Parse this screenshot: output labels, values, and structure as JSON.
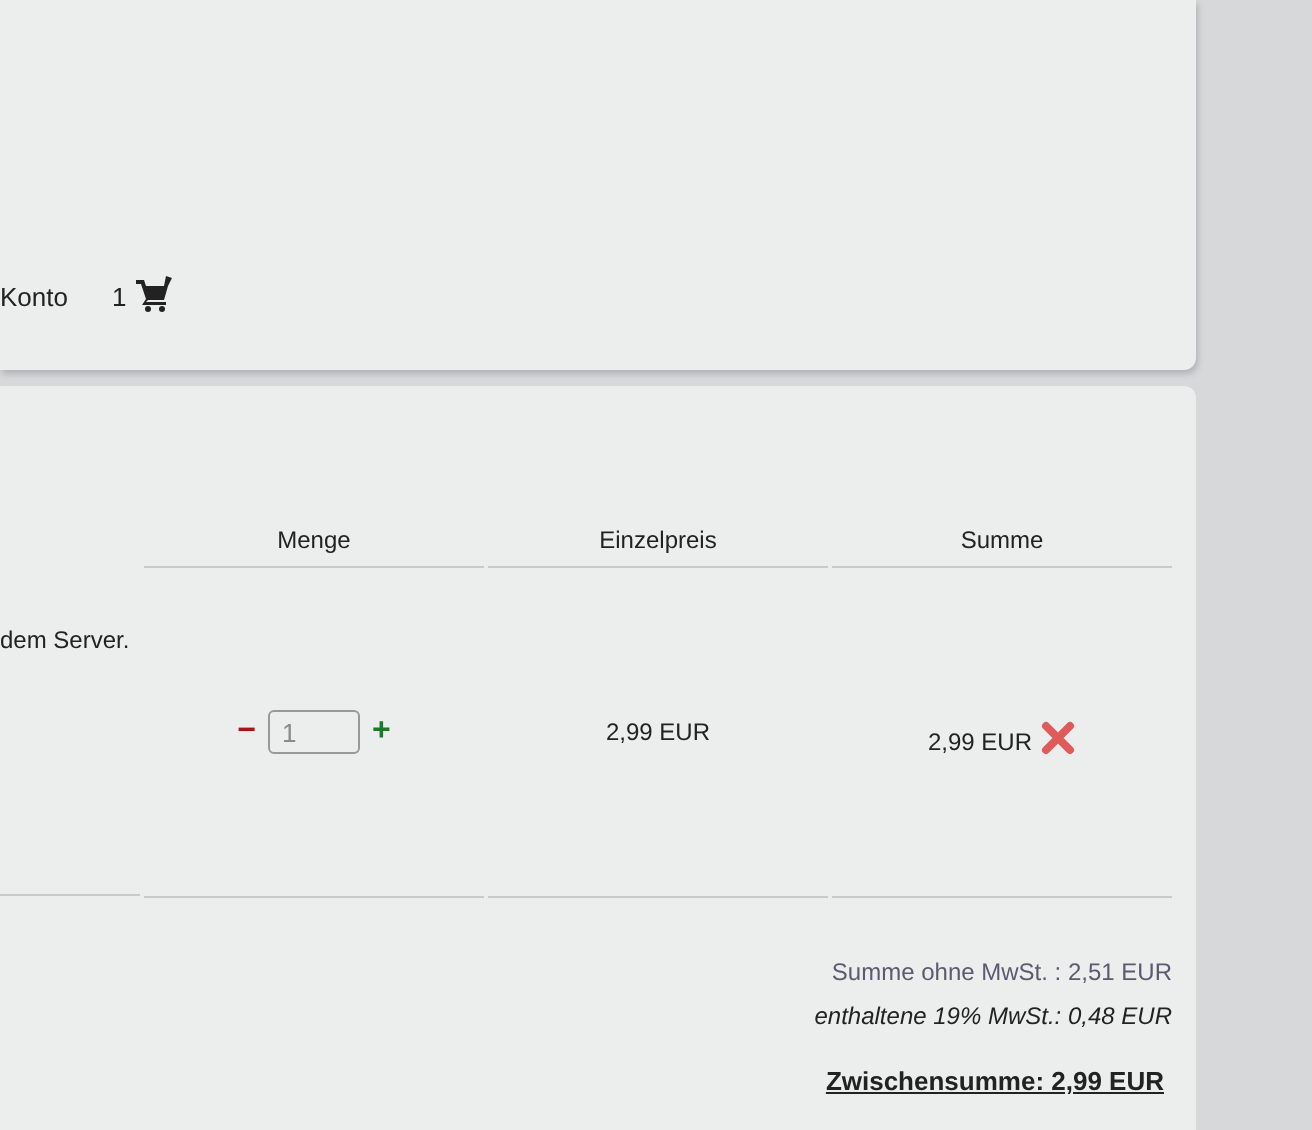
{
  "header": {
    "account_link": "Konto",
    "cart_count": "1"
  },
  "cart": {
    "columns": [
      "Menge",
      "Einzelpreis",
      "Summe"
    ],
    "rows": [
      {
        "description": "dem Server.",
        "decrease": "−",
        "quantity": "1",
        "increase": "+",
        "unit_price": "2,99 EUR",
        "total": "2,99 EUR"
      }
    ],
    "totals": {
      "net": "Summe ohne MwSt. : 2,51 EUR",
      "vat": "enthaltene 19% MwSt.: 0,48 EUR",
      "subtotal": "Zwischensumme: 2,99 EUR"
    }
  }
}
